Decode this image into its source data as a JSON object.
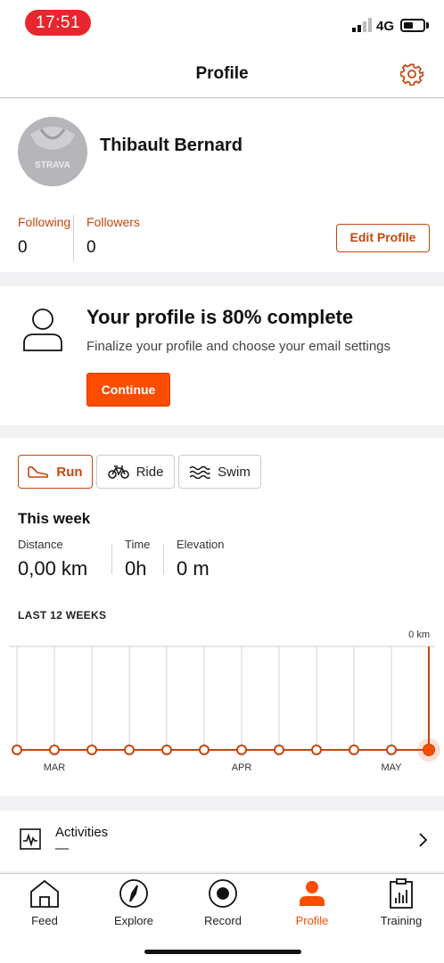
{
  "status_bar": {
    "time": "17:51",
    "network": "4G",
    "icons": [
      "signal-icon",
      "battery-icon"
    ]
  },
  "header": {
    "title": "Profile",
    "settings_icon": "gear-icon"
  },
  "profile": {
    "name": "Thibault Bernard",
    "avatar_text": "STRAVA",
    "following_label": "Following",
    "following_value": "0",
    "followers_label": "Followers",
    "followers_value": "0",
    "edit_label": "Edit Profile"
  },
  "completion": {
    "title": "Your profile is 80% complete",
    "subtitle": "Finalize your profile and choose your email settings",
    "continue_label": "Continue"
  },
  "sports": {
    "tabs": [
      {
        "label": "Run",
        "icon": "shoe-icon",
        "selected": true
      },
      {
        "label": "Ride",
        "icon": "bike-icon",
        "selected": false
      },
      {
        "label": "Swim",
        "icon": "waves-icon",
        "selected": false
      }
    ]
  },
  "this_week": {
    "heading": "This week",
    "distance_label": "Distance",
    "distance_value": "0,00 km",
    "time_label": "Time",
    "time_value": "0h",
    "elevation_label": "Elevation",
    "elevation_value": "0 m"
  },
  "chart_data": {
    "type": "line",
    "title": "LAST 12 WEEKS",
    "y_max_label": "0 km",
    "x_tick_labels": [
      "MAR",
      "APR",
      "MAY"
    ],
    "x_tick_indices": [
      1,
      6,
      10
    ],
    "series": [
      {
        "values": [
          0,
          0,
          0,
          0,
          0,
          0,
          0,
          0,
          0,
          0,
          0,
          0
        ]
      }
    ],
    "highlight_index": 11,
    "colors": {
      "line": "#c4460f",
      "highlight": "#fc4c02"
    }
  },
  "activities": {
    "label": "Activities",
    "count": "—",
    "icon": "activity-chart-icon"
  },
  "nav": {
    "items": [
      {
        "label": "Feed",
        "icon": "home-icon"
      },
      {
        "label": "Explore",
        "icon": "compass-icon"
      },
      {
        "label": "Record",
        "icon": "record-icon"
      },
      {
        "label": "Profile",
        "icon": "profile-icon",
        "active": true
      },
      {
        "label": "Training",
        "icon": "clipboard-chart-icon"
      }
    ]
  },
  "colors": {
    "accent": "#fc4c02",
    "accent_dark": "#c4460f",
    "status_pill": "#e8262d"
  }
}
